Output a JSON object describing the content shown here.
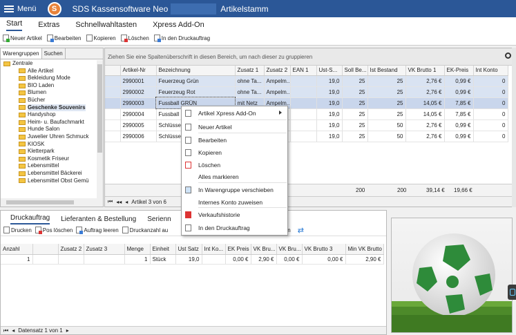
{
  "titlebar": {
    "menu_label": "Menü",
    "app_title": "SDS Kassensoftware Neo",
    "module": "Artikelstamm"
  },
  "ribbon_tabs": [
    "Start",
    "Extras",
    "Schnellwahltasten",
    "Xpress Add-On"
  ],
  "toolbar": {
    "new_article": "Neuer Artikel",
    "edit": "Bearbeiten",
    "copy": "Kopieren",
    "delete": "Löschen",
    "print_order": "In den Druckauftrag"
  },
  "left_panel": {
    "tabs": [
      "Warengruppen",
      "Suchen"
    ],
    "tree": [
      {
        "label": "Zentrale",
        "level": 0
      },
      {
        "label": "Alle Artikel",
        "level": 1
      },
      {
        "label": "Bekleidung Mode",
        "level": 1
      },
      {
        "label": "BIO Laden",
        "level": 1
      },
      {
        "label": "Blumen",
        "level": 1
      },
      {
        "label": "Bücher",
        "level": 1
      },
      {
        "label": "Geschenke Souvenirs",
        "level": 1,
        "selected": true
      },
      {
        "label": "Handyshop",
        "level": 1
      },
      {
        "label": "Heim- u. Baufachmarkt",
        "level": 1
      },
      {
        "label": "Hunde Salon",
        "level": 1
      },
      {
        "label": "Juwelier Uhren Schmuck",
        "level": 1
      },
      {
        "label": "KIOSK",
        "level": 1
      },
      {
        "label": "Kletterpark",
        "level": 1
      },
      {
        "label": "Kosmetik Friseur",
        "level": 1
      },
      {
        "label": "Lebensmittel",
        "level": 1
      },
      {
        "label": "Lebensmittel Bäckerei",
        "level": 1
      },
      {
        "label": "Lebensmittel Obst Gemü",
        "level": 1
      }
    ]
  },
  "grid": {
    "group_hint": "Ziehen Sie eine Spaltenüberschrift in diesen Bereich, um nach dieser zu gruppieren",
    "columns": [
      "",
      "Artikel-Nr",
      "Bezeichnung",
      "Zusatz 1",
      "Zusatz 2",
      "EAN 1",
      "Ust-S...",
      "Soll Be...",
      "Ist Bestand",
      "VK Brutto 1",
      "EK-Preis",
      "Int Konto"
    ],
    "rows": [
      {
        "nr": "2990001",
        "desc": "Feuerzeug Grün",
        "z1": "ohne Ta...",
        "z2": "Ampelm...",
        "ean": "",
        "ust": "19,0",
        "soll": "25",
        "ist": "25",
        "vk": "2,76 €",
        "ek": "0,99 €",
        "konto": "0",
        "state": "sel"
      },
      {
        "nr": "2990002",
        "desc": "Feuerzeug Rot",
        "z1": "ohne Ta...",
        "z2": "Ampelm...",
        "ean": "",
        "ust": "19,0",
        "soll": "25",
        "ist": "25",
        "vk": "2,76 €",
        "ek": "0,99 €",
        "konto": "0",
        "state": "sel"
      },
      {
        "nr": "2990003",
        "desc": "Fussball GRÜN",
        "z1": "mit Netz",
        "z2": "Ampelm...",
        "ean": "",
        "ust": "19,0",
        "soll": "25",
        "ist": "25",
        "vk": "14,05 €",
        "ek": "7,85 €",
        "konto": "0",
        "state": "focus"
      },
      {
        "nr": "2990004",
        "desc": "Fussball R",
        "z1": "",
        "z2": "",
        "ean": "",
        "ust": "19,0",
        "soll": "25",
        "ist": "25",
        "vk": "14,05 €",
        "ek": "7,85 €",
        "konto": "0",
        "state": ""
      },
      {
        "nr": "2990005",
        "desc": "Schlüssel",
        "z1": "",
        "z2": "",
        "ean": "",
        "ust": "19,0",
        "soll": "25",
        "ist": "50",
        "vk": "2,76 €",
        "ek": "0,99 €",
        "konto": "0",
        "state": ""
      },
      {
        "nr": "2990006",
        "desc": "Schlüssel",
        "z1": "",
        "z2": "",
        "ean": "",
        "ust": "19,0",
        "soll": "25",
        "ist": "50",
        "vk": "2,76 €",
        "ek": "0,99 €",
        "konto": "0",
        "state": ""
      }
    ],
    "sums": {
      "soll": "200",
      "ist": "200",
      "vk": "39,14 €",
      "ek": "19,66 €"
    },
    "footer_text": "Artikel 3 von 6"
  },
  "context_menu": {
    "items": [
      {
        "label": "Artikel Xpress Add-On",
        "submenu": true
      },
      {
        "label": "Neuer Artikel"
      },
      {
        "label": "Bearbeiten"
      },
      {
        "label": "Kopieren"
      },
      {
        "label": "Löschen"
      },
      {
        "label": "Alles markieren"
      },
      {
        "label": "In Warengruppe verschieben"
      },
      {
        "label": "Internes Konto zuweisen"
      },
      {
        "label": "Verkaufshistorie"
      },
      {
        "label": "In den Druckauftrag"
      }
    ]
  },
  "bottom": {
    "tabs": [
      "Druckauftrag",
      "Lieferanten & Bestellung",
      "Serienn"
    ],
    "toolbar": {
      "print": "Drucken",
      "pos_delete": "Pos löschen",
      "clear": "Auftrag leeren",
      "print_count": "Druckanzahl au",
      "refresh": "ktualisieren"
    },
    "columns": [
      "Anzahl",
      "",
      "Zusatz 2",
      "Zusatz 3",
      "Menge",
      "Einheit",
      "Ust Satz",
      "Int Ko...",
      "EK Preis",
      "VK Bru...",
      "VK Bru...",
      "VK Brutto 3",
      "Min VK Brutto"
    ],
    "row": {
      "anzahl": "1",
      "menge": "1",
      "einheit": "Stück",
      "ust": "19,0",
      "ek": "0,00 €",
      "vk1": "2,90 €",
      "vk2": "0,00 €",
      "vk3": "0,00 €",
      "min": "2,90 €"
    },
    "footer_text": "Datensatz 1 von 1"
  },
  "colors": {
    "titlebar": "#2b5797",
    "selection": "#d9e3f2",
    "accent": "#2b5797"
  },
  "icons": [
    "hamburger-menu-icon",
    "sds-logo-icon",
    "search-icon",
    "folder-icon",
    "submenu-arrow-icon",
    "soccer-ball-image"
  ]
}
